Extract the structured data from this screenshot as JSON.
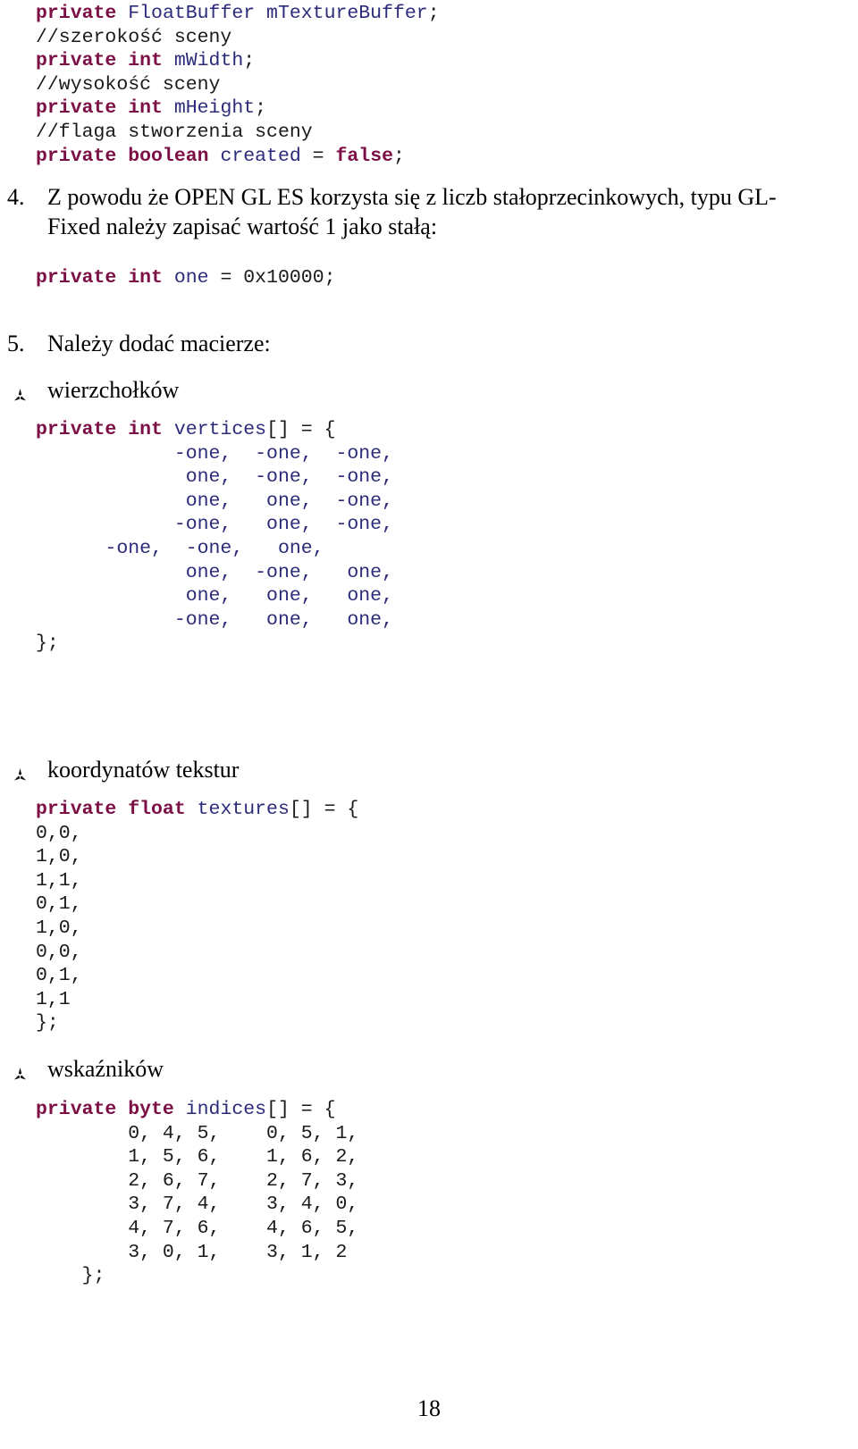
{
  "page": {
    "number": "18",
    "language": "pl"
  },
  "colors": {
    "keyword": "#7b0f46",
    "identifier": "#2b2b7a",
    "plain": "#1a1a1a",
    "background": "#ffffff"
  },
  "fields_block": {
    "lines": [
      [
        {
          "t": "private",
          "c": "kw"
        },
        {
          "t": " ",
          "c": "pl"
        },
        {
          "t": "FloatBuffer mTextureBuffer",
          "c": "id"
        },
        {
          "t": ";",
          "c": "pl"
        }
      ],
      [
        {
          "t": "//szerokość sceny",
          "c": "cm"
        }
      ],
      [
        {
          "t": "private int",
          "c": "kw"
        },
        {
          "t": " ",
          "c": "pl"
        },
        {
          "t": "mWidth",
          "c": "id"
        },
        {
          "t": ";",
          "c": "pl"
        }
      ],
      [
        {
          "t": "//wysokość sceny",
          "c": "cm"
        }
      ],
      [
        {
          "t": "private int",
          "c": "kw"
        },
        {
          "t": " ",
          "c": "pl"
        },
        {
          "t": "mHeight",
          "c": "id"
        },
        {
          "t": ";",
          "c": "pl"
        }
      ],
      [
        {
          "t": "//flaga stworzenia sceny",
          "c": "cm"
        }
      ],
      [
        {
          "t": "private boolean",
          "c": "kw"
        },
        {
          "t": " ",
          "c": "pl"
        },
        {
          "t": "created",
          "c": "id"
        },
        {
          "t": " = ",
          "c": "pl"
        },
        {
          "t": "false",
          "c": "kw"
        },
        {
          "t": ";",
          "c": "pl"
        }
      ]
    ]
  },
  "item4": {
    "marker": "4.",
    "text": "Z powodu że OPEN GL ES korzysta się z liczb stałoprzecinkowych, typu GL-Fixed należy zapisać wartość 1 jako stałą:"
  },
  "code_one": {
    "lines": [
      [
        {
          "t": "private int",
          "c": "kw"
        },
        {
          "t": " ",
          "c": "pl"
        },
        {
          "t": "one",
          "c": "id"
        },
        {
          "t": " = ",
          "c": "pl"
        },
        {
          "t": "0x10000",
          "c": "pl"
        },
        {
          "t": ";",
          "c": "pl"
        }
      ]
    ]
  },
  "item5": {
    "marker": "5.",
    "text": "Należy dodać macierze:"
  },
  "bullet_vertices": {
    "icon": "tripod-bullet-icon",
    "text": "wierzchołków"
  },
  "code_vertices": {
    "lines": [
      [
        {
          "t": "private int",
          "c": "kw"
        },
        {
          "t": " ",
          "c": "pl"
        },
        {
          "t": "vertices",
          "c": "id"
        },
        {
          "t": "[] = {",
          "c": "pl"
        }
      ],
      [
        {
          "t": "            -one,  -one,  -one,",
          "c": "id"
        }
      ],
      [
        {
          "t": "             one,  -one,  -one,",
          "c": "id"
        }
      ],
      [
        {
          "t": "             one,   one,  -one,",
          "c": "id"
        }
      ],
      [
        {
          "t": "            -one,   one,  -one,",
          "c": "id"
        }
      ],
      [
        {
          "t": "      -one,  -one,   one,",
          "c": "id"
        }
      ],
      [
        {
          "t": "             one,  -one,   one,",
          "c": "id"
        }
      ],
      [
        {
          "t": "             one,   one,   one,",
          "c": "id"
        }
      ],
      [
        {
          "t": "            -one,   one,   one,",
          "c": "id"
        }
      ],
      [
        {
          "t": "};",
          "c": "pl"
        }
      ]
    ]
  },
  "bullet_textures": {
    "icon": "tripod-bullet-icon",
    "text": "koordynatów tekstur"
  },
  "code_textures": {
    "lines": [
      [
        {
          "t": "private float",
          "c": "kw"
        },
        {
          "t": " ",
          "c": "pl"
        },
        {
          "t": "textures",
          "c": "id"
        },
        {
          "t": "[] = {",
          "c": "pl"
        }
      ],
      [
        {
          "t": "0,0,",
          "c": "pl"
        }
      ],
      [
        {
          "t": "1,0,",
          "c": "pl"
        }
      ],
      [
        {
          "t": "1,1,",
          "c": "pl"
        }
      ],
      [
        {
          "t": "0,1,",
          "c": "pl"
        }
      ],
      [
        {
          "t": "1,0,",
          "c": "pl"
        }
      ],
      [
        {
          "t": "0,0,",
          "c": "pl"
        }
      ],
      [
        {
          "t": "0,1,",
          "c": "pl"
        }
      ],
      [
        {
          "t": "1,1",
          "c": "pl"
        }
      ],
      [
        {
          "t": "};",
          "c": "pl"
        }
      ]
    ]
  },
  "bullet_indices": {
    "icon": "tripod-bullet-icon",
    "text": "wskaźników"
  },
  "code_indices": {
    "lines": [
      [
        {
          "t": "private byte",
          "c": "kw"
        },
        {
          "t": " ",
          "c": "pl"
        },
        {
          "t": "indices",
          "c": "id"
        },
        {
          "t": "[] = {",
          "c": "pl"
        }
      ],
      [
        {
          "t": "        0, 4, 5,    0, 5, 1,",
          "c": "pl"
        }
      ],
      [
        {
          "t": "        1, 5, 6,    1, 6, 2,",
          "c": "pl"
        }
      ],
      [
        {
          "t": "        2, 6, 7,    2, 7, 3,",
          "c": "pl"
        }
      ],
      [
        {
          "t": "        3, 7, 4,    3, 4, 0,",
          "c": "pl"
        }
      ],
      [
        {
          "t": "        4, 7, 6,    4, 6, 5,",
          "c": "pl"
        }
      ],
      [
        {
          "t": "        3, 0, 1,    3, 1, 2",
          "c": "pl"
        }
      ],
      [
        {
          "t": "    };",
          "c": "pl"
        }
      ]
    ]
  }
}
